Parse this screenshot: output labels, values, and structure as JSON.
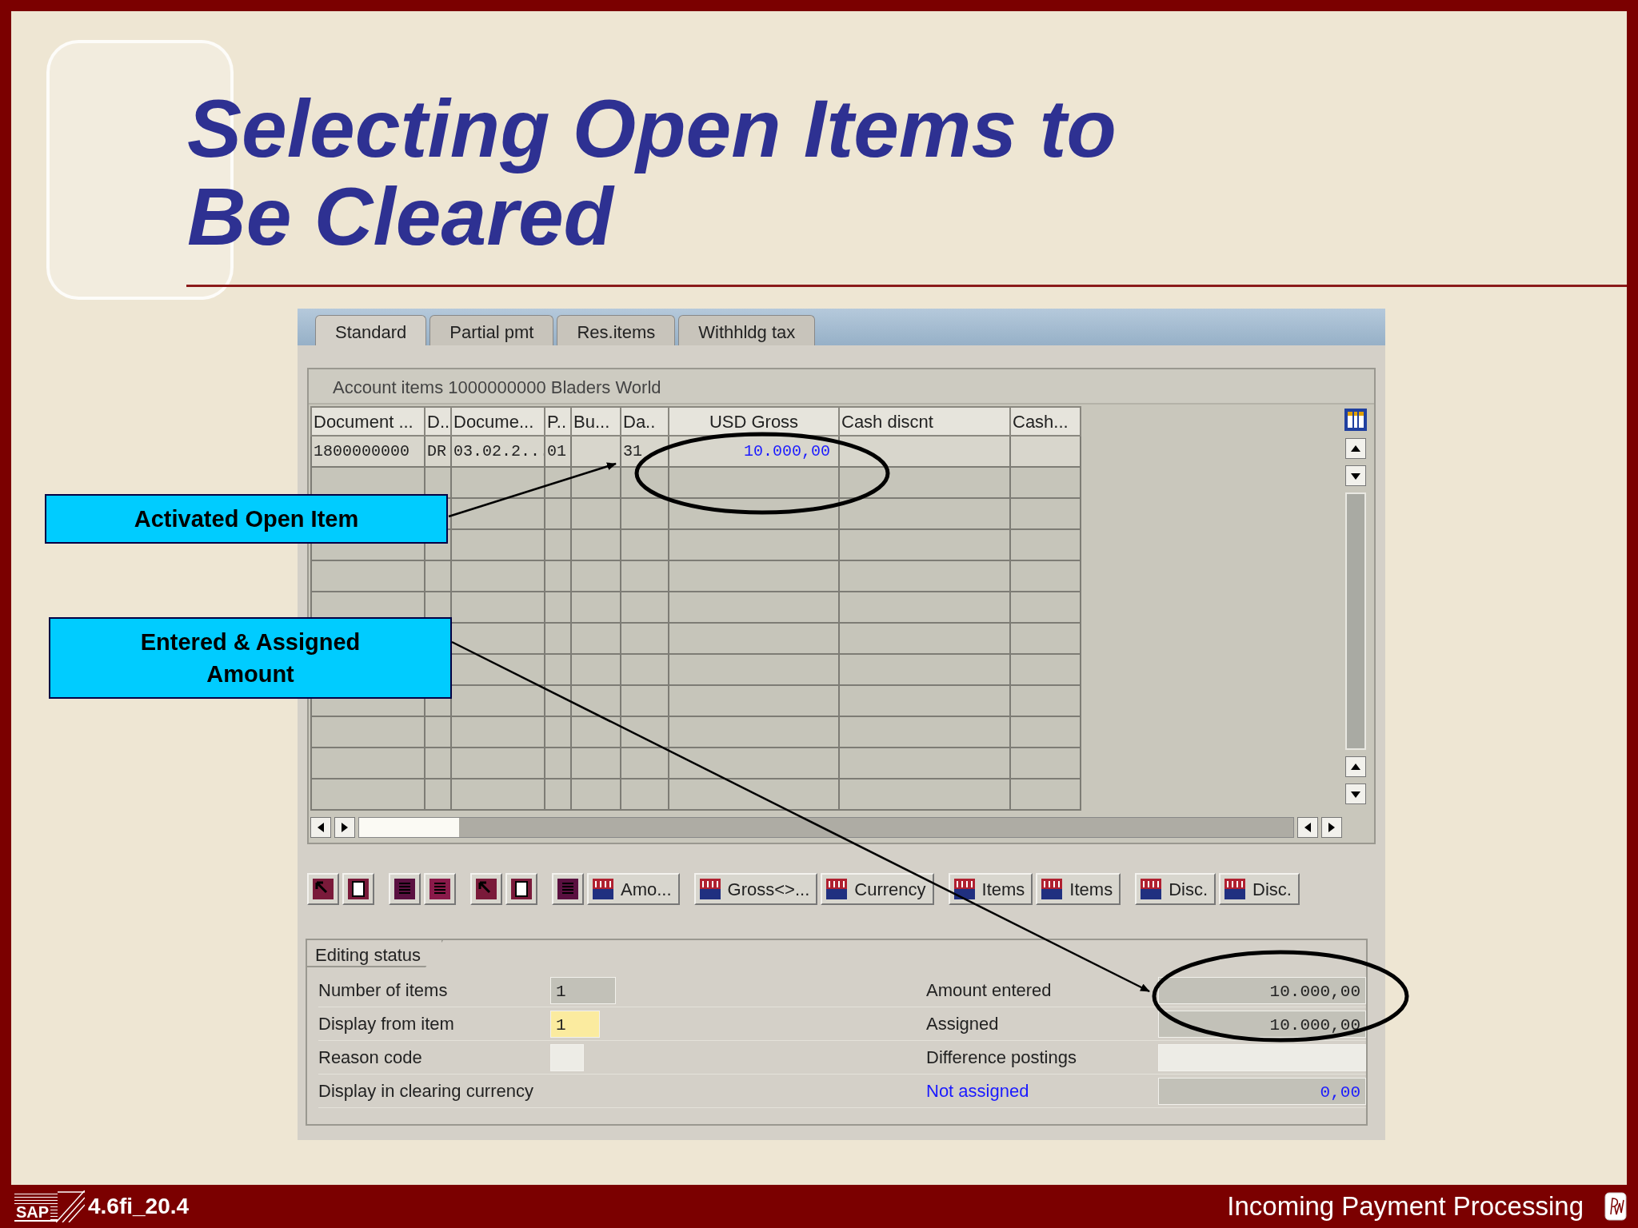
{
  "slide": {
    "title_lines": [
      "Selecting Open Items to",
      "Be Cleared"
    ]
  },
  "tabs": [
    {
      "label": "Standard",
      "selected": true
    },
    {
      "label": "Partial pmt",
      "selected": false
    },
    {
      "label": "Res.items",
      "selected": false
    },
    {
      "label": "Withhldg tax",
      "selected": false
    }
  ],
  "account_header": "Account items 1000000000 Bladers World",
  "table": {
    "columns": [
      "Document ...",
      "D..",
      "Docume...",
      "P..",
      "Bu...",
      "Da..",
      "USD Gross",
      "Cash discnt",
      "Cash..."
    ],
    "rows": [
      {
        "cells": [
          {
            "kind": "text",
            "text": "1800000000"
          },
          {
            "kind": "text",
            "text": "DR"
          },
          {
            "kind": "text",
            "text": "03.02.2..."
          },
          {
            "kind": "text",
            "text": "01"
          },
          {
            "kind": "text"
          },
          {
            "kind": "text",
            "text": "31"
          },
          {
            "kind": "amount",
            "text": "10.000,00"
          },
          {
            "kind": "input"
          },
          {
            "kind": "input"
          }
        ]
      }
    ]
  },
  "toolbar": [
    [
      {
        "kind": "icon"
      },
      {
        "kind": "icon"
      }
    ],
    [
      {
        "kind": "icon"
      },
      {
        "kind": "icon"
      }
    ],
    [
      {
        "kind": "icon"
      },
      {
        "kind": "icon"
      }
    ],
    [
      {
        "kind": "icon"
      },
      {
        "kind": "labeled",
        "label": "Amo..."
      }
    ],
    [
      {
        "kind": "labeled",
        "label": "Gross<>..."
      },
      {
        "kind": "labeled",
        "label": "Currency"
      }
    ],
    [
      {
        "kind": "labeled",
        "label": "Items"
      },
      {
        "kind": "labeled",
        "label": "Items"
      }
    ],
    [
      {
        "kind": "labeled",
        "label": "Disc."
      },
      {
        "kind": "labeled",
        "label": "Disc."
      }
    ]
  ],
  "editing_status": {
    "title": "Editing status",
    "left": [
      {
        "label": "Number of items",
        "kind": "readonly",
        "value": "1"
      },
      {
        "label": "Display from item",
        "kind": "input",
        "value": "1"
      },
      {
        "label": "Reason code",
        "kind": "empty"
      },
      {
        "label": "Display in clearing currency",
        "kind": "none"
      }
    ],
    "right": [
      {
        "label": "Amount entered",
        "kind": "readonly",
        "value": "10.000,00",
        "link": false
      },
      {
        "label": "Assigned",
        "kind": "readonly",
        "value": "10.000,00",
        "link": false
      },
      {
        "label": "Difference postings",
        "kind": "empty",
        "link": false
      },
      {
        "label": "Not assigned",
        "kind": "readonly",
        "value": "0,00",
        "link": true
      }
    ]
  },
  "callouts": [
    {
      "text": "Activated Open Item"
    },
    {
      "text": "Entered & Assigned Amount"
    }
  ],
  "footer": {
    "logo": "SAP",
    "code": "4.6fi_20.4",
    "title": "Incoming Payment Processing"
  }
}
